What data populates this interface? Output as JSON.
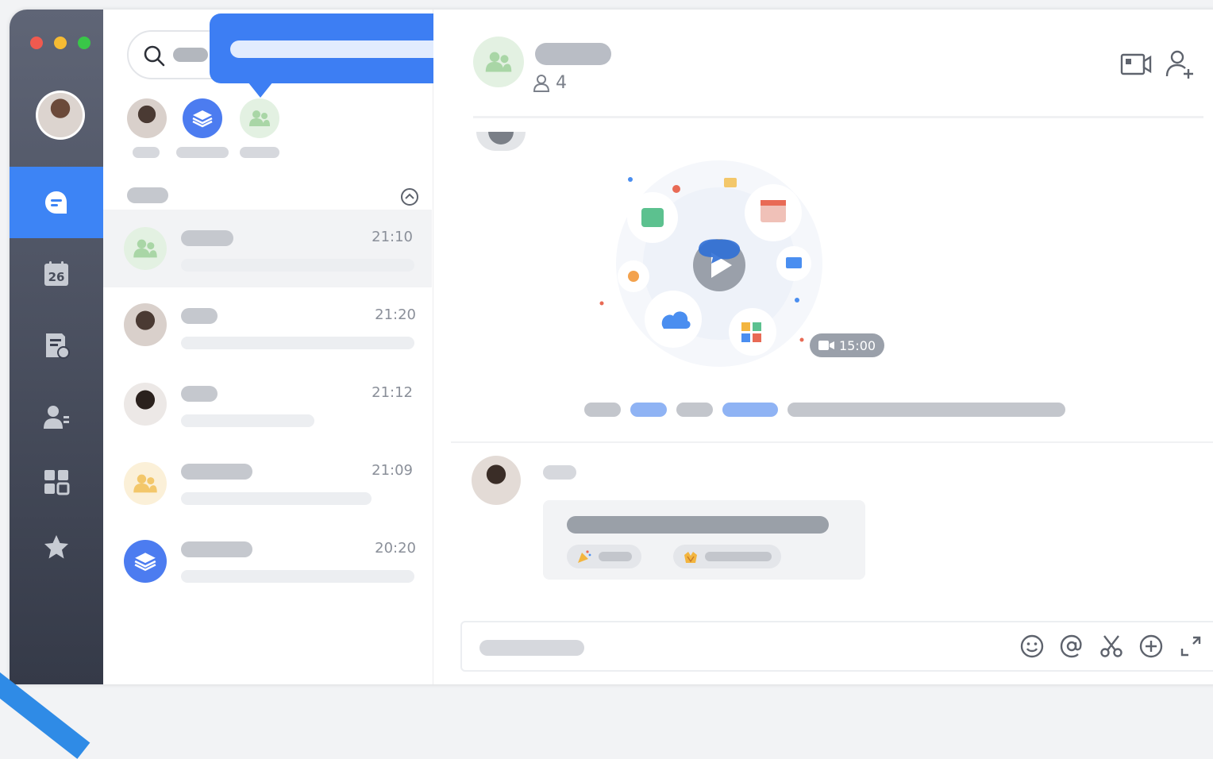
{
  "window_controls": {
    "close_color": "#f05a4f",
    "minimize_color": "#f6bb33",
    "maximize_color": "#39c648"
  },
  "rail": {
    "accent": "#3d84f5",
    "items": [
      {
        "icon": "chat-icon",
        "active": true
      },
      {
        "icon": "calendar-icon",
        "badge": "26"
      },
      {
        "icon": "docs-icon"
      },
      {
        "icon": "contacts-icon"
      },
      {
        "icon": "apps-grid-icon"
      },
      {
        "icon": "favorites-star-icon"
      }
    ]
  },
  "pinned": [
    {
      "icon": "avatar-photo"
    },
    {
      "icon": "team-stack-icon"
    },
    {
      "icon": "group-icon"
    }
  ],
  "conversations": [
    {
      "time": "21:10",
      "avatar_color": "#e3f1e2",
      "icon": "group-icon",
      "selected": true
    },
    {
      "time": "21:20",
      "avatar_color": "#d9d0cb",
      "icon": "avatar-photo"
    },
    {
      "time": "21:12",
      "avatar_color": "#ece8e6",
      "icon": "avatar-photo"
    },
    {
      "time": "21:09",
      "avatar_color": "#fbf0d8",
      "icon": "group-icon"
    },
    {
      "time": "20:20",
      "avatar_color": "#4c7cf0",
      "icon": "team-stack-icon"
    }
  ],
  "chat": {
    "member_count": "4",
    "video_duration": "15:00",
    "mention_color": "#3d7ef3"
  }
}
